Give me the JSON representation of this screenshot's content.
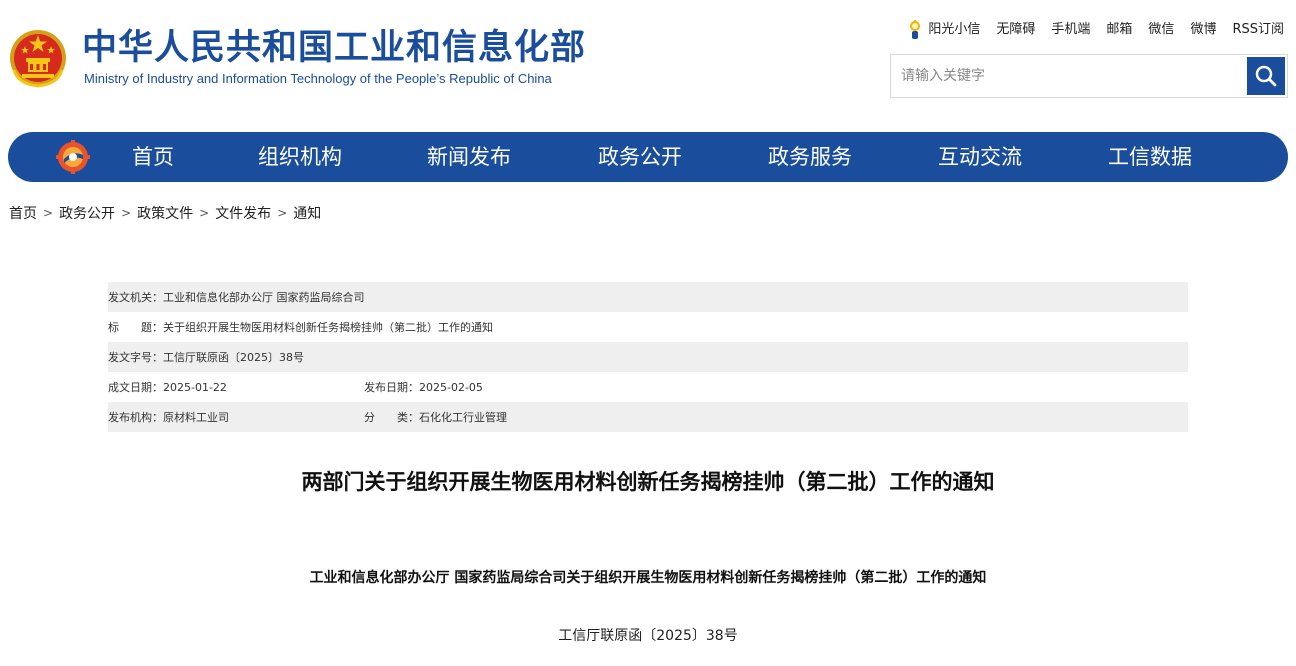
{
  "header": {
    "title": "中华人民共和国工业和信息化部",
    "subtitle": "Ministry of Industry and Information Technology of the People’s Republic of China",
    "emblem_icon": "national-emblem-icon",
    "brand_color": "#1a4d9c"
  },
  "toplinks": [
    {
      "label": "阳光小信",
      "icon": "sun-mascot-icon"
    },
    {
      "label": "无障碍"
    },
    {
      "label": "手机端"
    },
    {
      "label": "邮箱"
    },
    {
      "label": "微信"
    },
    {
      "label": "微博"
    },
    {
      "label": "RSS订阅"
    }
  ],
  "search": {
    "placeholder": "请输入关键字",
    "value": "",
    "button_icon": "search-icon"
  },
  "nav": {
    "logo_icon": "gear-logo-icon",
    "items": [
      "首页",
      "组织机构",
      "新闻发布",
      "政务公开",
      "政务服务",
      "互动交流",
      "工信数据"
    ]
  },
  "breadcrumb": [
    "首页",
    "政务公开",
    "政策文件",
    "文件发布",
    "通知"
  ],
  "meta": {
    "issuer_label": "发文机关：",
    "issuer_value": "工业和信息化部办公厅 国家药监局综合司",
    "title_label": "标　　题：",
    "title_value": "关于组织开展生物医用材料创新任务揭榜挂帅（第二批）工作的通知",
    "docno_label": "发文字号：",
    "docno_value": "工信厅联原函〔2025〕38号",
    "created_label": "成文日期：",
    "created_value": "2025-01-22",
    "published_label": "发布日期：",
    "published_value": "2025-02-05",
    "org_label": "发布机构：",
    "org_value": "原材料工业司",
    "category_label": "分　　类：",
    "category_value": "石化化工行业管理"
  },
  "article": {
    "title": "两部门关于组织开展生物医用材料创新任务揭榜挂帅（第二批）工作的通知",
    "subtitle": "工业和信息化部办公厅 国家药监局综合司关于组织开展生物医用材料创新任务揭榜挂帅（第二批）工作的通知",
    "doc_number": "工信厅联原函〔2025〕38号"
  }
}
